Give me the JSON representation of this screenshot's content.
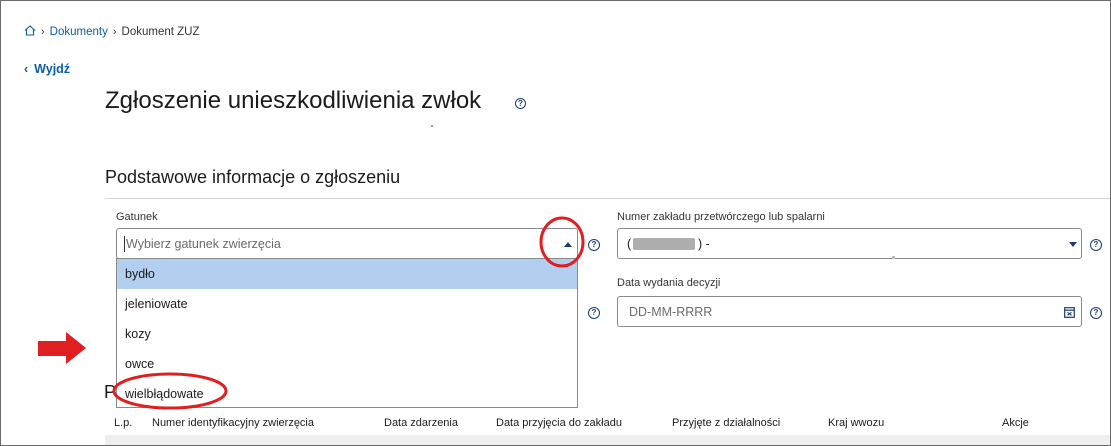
{
  "breadcrumb": {
    "items": [
      "Dokumenty",
      "Dokument ZUZ"
    ]
  },
  "nav": {
    "back_label": "Wyjdź"
  },
  "page": {
    "title": "Zgłoszenie unieszkodliwienia zwłok"
  },
  "section": {
    "title": "Podstawowe informacje o zgłoszeniu",
    "partial_heading": "P"
  },
  "form": {
    "species_label": "Gatunek",
    "species_placeholder": "Wybierz gatunek zwierzęcia",
    "species_options": [
      "bydło",
      "jeleniowate",
      "kozy",
      "owce",
      "wielbłądowate"
    ],
    "species_highlighted": "bydło",
    "plant_label": "Numer zakładu przetwórczego lub spalarni",
    "plant_value_prefix": "(",
    "plant_value_suffix": ") -",
    "decision_date_label": "Data wydania decyzji",
    "decision_date_placeholder": "DD-MM-RRRR"
  },
  "table": {
    "columns": [
      "L.p.",
      "Numer identyfikacyjny zwierzęcia",
      "Data zdarzenia",
      "Data przyjęcia do zakładu",
      "Przyjęte z działalności",
      "Kraj wwozu",
      "Akcje"
    ]
  },
  "icons": {
    "home": "home-icon",
    "chevron_right": "chevron-right-icon",
    "chevron_left": "chevron-left-icon",
    "help": "help-icon",
    "calendar": "calendar-icon",
    "annotation_arrow": "arrow-icon"
  },
  "colors": {
    "link": "#0b5cad",
    "highlight": "#b3cff0",
    "annotation_red": "#e02020"
  }
}
